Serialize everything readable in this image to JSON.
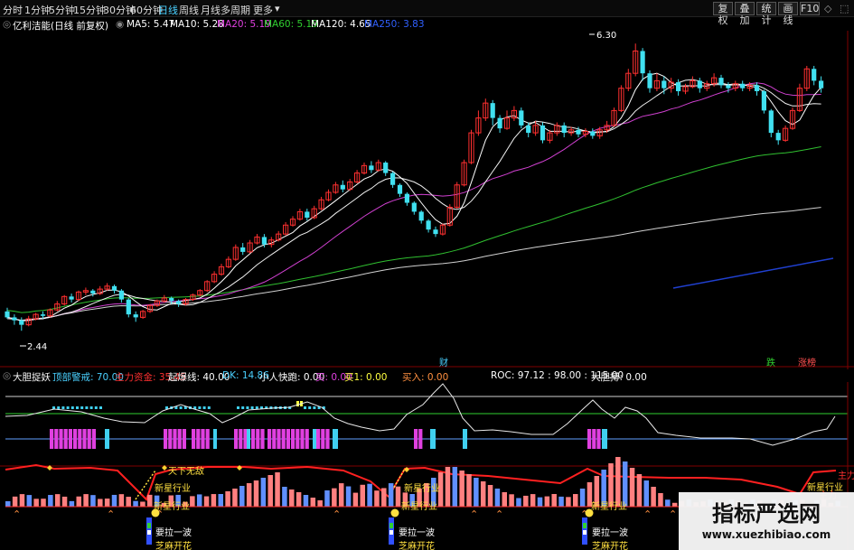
{
  "toolbar": {
    "timeframes": [
      {
        "label": "分时",
        "active": false
      },
      {
        "label": "1分钟",
        "active": false
      },
      {
        "label": "5分钟",
        "active": false
      },
      {
        "label": "15分钟",
        "active": false
      },
      {
        "label": "30分钟",
        "active": false
      },
      {
        "label": "60分钟",
        "active": false
      },
      {
        "label": "日线",
        "active": true
      },
      {
        "label": "周线",
        "active": false
      },
      {
        "label": "月线",
        "active": false
      },
      {
        "label": "多周期",
        "active": false
      },
      {
        "label": "更多",
        "active": false
      }
    ],
    "buttons": [
      "复权",
      "叠加",
      "统计",
      "画线",
      "F10"
    ],
    "window_icons": [
      "◇",
      "⬚"
    ]
  },
  "price_panel": {
    "stock": "亿利洁能(日线 前复权)",
    "ma": [
      {
        "label": "MA5: 5.47",
        "color": "#ffffff"
      },
      {
        "label": "MA10: 5.28",
        "color": "#ffffff"
      },
      {
        "label": "MA20: 5.19",
        "color": "#e040e0"
      },
      {
        "label": "MA60: 5.19",
        "color": "#30d030"
      },
      {
        "label": "MA120: 4.65",
        "color": "#ffffff"
      },
      {
        "label": "MA250: 3.83",
        "color": "#3060ff"
      }
    ],
    "high_label": "6.30",
    "low_label": "2.44",
    "markers": [
      {
        "label": "财",
        "color": "#4ad0ff"
      },
      {
        "label": "跌",
        "color": "#30d030"
      },
      {
        "label": "涨榜",
        "color": "#ff5050"
      }
    ]
  },
  "indicator_panel": {
    "name": "大胆捉妖",
    "fields": [
      {
        "label": "顶部警戒: 70.00",
        "color": "#4ad0ff"
      },
      {
        "label": "主力资金: 35.45",
        "color": "#ff3030"
      },
      {
        "label": "起爆线: 40.00",
        "color": "#ffffff"
      },
      {
        "label": "DK: 14.86",
        "color": "#4ad0ff"
      },
      {
        "label": "小人快跑: 0.00",
        "color": "#ffffff"
      },
      {
        "label": "买: 0.00",
        "color": "#e040e0"
      },
      {
        "label": "买1: 0.00",
        "color": "#ffff40"
      },
      {
        "label": "买入: 0.00",
        "color": "#ff9040"
      },
      {
        "label": "ROC: 97.12 : 98.00 : 115.00",
        "color": "#ffffff"
      },
      {
        "label": "大胆搏: 0.00",
        "color": "#ffffff"
      }
    ]
  },
  "signals": {
    "labels": [
      "天下无敌",
      "新星行业",
      "新星行业",
      "新星行业",
      "主力"
    ],
    "boxes": [
      {
        "line1": "要拉一波",
        "line2": "芝麻开花"
      },
      {
        "line1": "要拉一波",
        "line2": "芝麻开花"
      },
      {
        "line1": "要拉一波",
        "line2": "芝麻开花"
      }
    ],
    "extras": [
      "主力",
      "新星行业",
      "新星行业",
      "新星行业"
    ]
  },
  "watermark": {
    "title": "指标严选网",
    "url": "www.xuezhibiao.com"
  },
  "chart_data": {
    "type": "candlestick",
    "y_min": 2.2,
    "y_max": 6.4,
    "candles": [
      [
        2.7,
        2.62,
        2.75,
        2.6
      ],
      [
        2.62,
        2.58,
        2.66,
        2.52
      ],
      [
        2.58,
        2.52,
        2.62,
        2.44
      ],
      [
        2.52,
        2.6,
        2.64,
        2.5
      ],
      [
        2.6,
        2.66,
        2.68,
        2.58
      ],
      [
        2.66,
        2.64,
        2.7,
        2.6
      ],
      [
        2.64,
        2.72,
        2.74,
        2.62
      ],
      [
        2.72,
        2.8,
        2.84,
        2.7
      ],
      [
        2.8,
        2.9,
        2.92,
        2.78
      ],
      [
        2.9,
        2.86,
        2.94,
        2.82
      ],
      [
        2.86,
        2.96,
        2.98,
        2.84
      ],
      [
        2.96,
        2.98,
        3.02,
        2.92
      ],
      [
        2.98,
        2.94,
        3.0,
        2.9
      ],
      [
        2.94,
        3.0,
        3.04,
        2.92
      ],
      [
        3.0,
        3.04,
        3.08,
        2.98
      ],
      [
        3.04,
        2.98,
        3.06,
        2.94
      ],
      [
        2.98,
        2.86,
        3.0,
        2.82
      ],
      [
        2.86,
        2.66,
        2.88,
        2.62
      ],
      [
        2.66,
        2.62,
        2.7,
        2.56
      ],
      [
        2.62,
        2.7,
        2.72,
        2.6
      ],
      [
        2.7,
        2.78,
        2.8,
        2.68
      ],
      [
        2.78,
        2.84,
        2.86,
        2.76
      ],
      [
        2.84,
        2.88,
        2.92,
        2.82
      ],
      [
        2.88,
        2.84,
        2.9,
        2.8
      ],
      [
        2.84,
        2.8,
        2.86,
        2.76
      ],
      [
        2.8,
        2.86,
        2.88,
        2.78
      ],
      [
        2.86,
        2.92,
        2.94,
        2.84
      ],
      [
        2.92,
        2.98,
        3.0,
        2.9
      ],
      [
        2.98,
        3.1,
        3.12,
        2.96
      ],
      [
        3.1,
        3.2,
        3.24,
        3.08
      ],
      [
        3.2,
        3.3,
        3.34,
        3.18
      ],
      [
        3.3,
        3.4,
        3.44,
        3.28
      ],
      [
        3.4,
        3.56,
        3.6,
        3.38
      ],
      [
        3.56,
        3.5,
        3.62,
        3.46
      ],
      [
        3.5,
        3.62,
        3.66,
        3.48
      ],
      [
        3.62,
        3.7,
        3.74,
        3.6
      ],
      [
        3.7,
        3.6,
        3.74,
        3.56
      ],
      [
        3.6,
        3.66,
        3.7,
        3.56
      ],
      [
        3.66,
        3.74,
        3.78,
        3.64
      ],
      [
        3.74,
        3.86,
        3.9,
        3.72
      ],
      [
        3.86,
        3.94,
        3.98,
        3.84
      ],
      [
        3.94,
        4.04,
        4.08,
        3.92
      ],
      [
        4.04,
        3.96,
        4.08,
        3.92
      ],
      [
        3.96,
        4.08,
        4.12,
        3.94
      ],
      [
        4.08,
        4.2,
        4.24,
        4.06
      ],
      [
        4.2,
        4.3,
        4.34,
        4.18
      ],
      [
        4.3,
        4.4,
        4.44,
        4.28
      ],
      [
        4.4,
        4.34,
        4.46,
        4.3
      ],
      [
        4.34,
        4.44,
        4.48,
        4.32
      ],
      [
        4.44,
        4.56,
        4.6,
        4.42
      ],
      [
        4.56,
        4.66,
        4.7,
        4.54
      ],
      [
        4.66,
        4.6,
        4.72,
        4.56
      ],
      [
        4.6,
        4.7,
        4.74,
        4.58
      ],
      [
        4.7,
        4.56,
        4.72,
        4.52
      ],
      [
        4.56,
        4.4,
        4.58,
        4.36
      ],
      [
        4.4,
        4.28,
        4.42,
        4.24
      ],
      [
        4.28,
        4.16,
        4.3,
        4.12
      ],
      [
        4.16,
        4.04,
        4.18,
        4.0
      ],
      [
        4.04,
        3.92,
        4.06,
        3.88
      ],
      [
        3.92,
        3.8,
        3.94,
        3.76
      ],
      [
        3.8,
        3.74,
        3.84,
        3.7
      ],
      [
        3.74,
        3.86,
        3.88,
        3.72
      ],
      [
        3.86,
        4.1,
        4.14,
        3.84
      ],
      [
        4.1,
        4.4,
        4.44,
        4.08
      ],
      [
        4.4,
        4.7,
        4.74,
        4.38
      ],
      [
        4.7,
        5.1,
        5.14,
        4.68
      ],
      [
        5.1,
        5.3,
        5.4,
        5.06
      ],
      [
        5.3,
        5.5,
        5.56,
        5.26
      ],
      [
        5.5,
        5.3,
        5.54,
        5.2
      ],
      [
        5.3,
        5.16,
        5.34,
        5.1
      ],
      [
        5.16,
        5.3,
        5.4,
        5.14
      ],
      [
        5.3,
        5.4,
        5.46,
        5.26
      ],
      [
        5.4,
        5.2,
        5.44,
        5.16
      ],
      [
        5.2,
        5.1,
        5.24,
        5.04
      ],
      [
        5.1,
        5.2,
        5.26,
        5.06
      ],
      [
        5.2,
        5.0,
        5.24,
        4.96
      ],
      [
        5.0,
        5.1,
        5.14,
        4.96
      ],
      [
        5.1,
        5.2,
        5.24,
        5.06
      ],
      [
        5.2,
        5.1,
        5.24,
        5.04
      ],
      [
        5.1,
        5.14,
        5.18,
        5.06
      ],
      [
        5.14,
        5.08,
        5.18,
        5.04
      ],
      [
        5.08,
        5.12,
        5.16,
        5.04
      ],
      [
        5.12,
        5.06,
        5.16,
        5.02
      ],
      [
        5.06,
        5.14,
        5.18,
        5.02
      ],
      [
        5.14,
        5.2,
        5.26,
        5.1
      ],
      [
        5.2,
        5.4,
        5.44,
        5.18
      ],
      [
        5.4,
        5.7,
        5.74,
        5.38
      ],
      [
        5.7,
        5.9,
        5.96,
        5.66
      ],
      [
        5.9,
        6.2,
        6.3,
        5.86
      ],
      [
        6.2,
        5.9,
        6.24,
        5.8
      ],
      [
        5.9,
        5.7,
        5.94,
        5.64
      ],
      [
        5.7,
        5.8,
        5.9,
        5.66
      ],
      [
        5.8,
        5.7,
        5.86,
        5.62
      ],
      [
        5.7,
        5.78,
        5.84,
        5.64
      ],
      [
        5.78,
        5.66,
        5.82,
        5.6
      ],
      [
        5.66,
        5.72,
        5.76,
        5.62
      ],
      [
        5.72,
        5.8,
        5.86,
        5.7
      ],
      [
        5.8,
        5.7,
        5.84,
        5.64
      ],
      [
        5.7,
        5.76,
        5.8,
        5.66
      ],
      [
        5.76,
        5.84,
        5.9,
        5.72
      ],
      [
        5.84,
        5.74,
        5.88,
        5.7
      ],
      [
        5.74,
        5.7,
        5.78,
        5.64
      ],
      [
        5.7,
        5.76,
        5.8,
        5.66
      ],
      [
        5.76,
        5.7,
        5.8,
        5.66
      ],
      [
        5.7,
        5.74,
        5.78,
        5.66
      ],
      [
        5.74,
        5.66,
        5.78,
        5.6
      ],
      [
        5.66,
        5.4,
        5.68,
        5.36
      ],
      [
        5.4,
        5.1,
        5.42,
        5.04
      ],
      [
        5.1,
        5.0,
        5.14,
        4.94
      ],
      [
        5.0,
        5.16,
        5.2,
        4.98
      ],
      [
        5.16,
        5.4,
        5.44,
        5.14
      ],
      [
        5.4,
        5.7,
        5.76,
        5.38
      ],
      [
        5.7,
        5.96,
        6.0,
        5.66
      ],
      [
        5.96,
        5.8,
        6.0,
        5.74
      ],
      [
        5.8,
        5.7,
        5.86,
        5.64
      ]
    ]
  }
}
